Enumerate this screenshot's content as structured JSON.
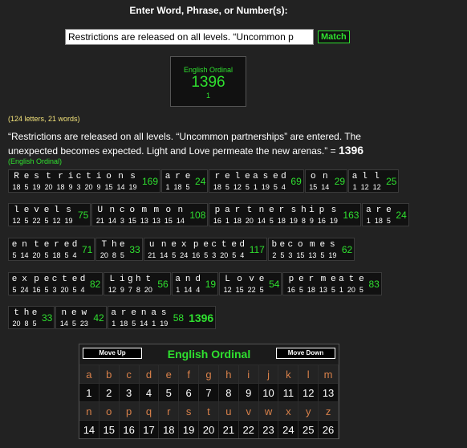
{
  "header": {
    "label": "Enter Word, Phrase, or Number(s):"
  },
  "input": {
    "value": "Restrictions are released on all levels.  “Uncommon p"
  },
  "match_button": {
    "label": "Match"
  },
  "cipher_box": {
    "name": "English Ordinal",
    "total": "1396",
    "rank": "1"
  },
  "counts": "(124 letters, 21 words)",
  "quote": {
    "text": "“Restrictions are released on all levels. “Uncommon partnerships” are entered. The unexpected becomes expected. Light and Love permeate the new arenas.”",
    "equals": " = ",
    "total": "1396",
    "cipher": "(English Ordinal)"
  },
  "rows": [
    [
      {
        "word": "Restrictions",
        "values": [
          "18",
          "5",
          "19",
          "20",
          "18",
          "9",
          "3",
          "20",
          "9",
          "15",
          "14",
          "19"
        ],
        "sum": "169"
      },
      {
        "word": "are",
        "values": [
          "1",
          "18",
          "5"
        ],
        "sum": "24"
      },
      {
        "word": "released",
        "values": [
          "18",
          "5",
          "12",
          "5",
          "1",
          "19",
          "5",
          "4"
        ],
        "sum": "69"
      },
      {
        "word": "on",
        "values": [
          "15",
          "14"
        ],
        "sum": "29"
      },
      {
        "word": "all",
        "values": [
          "1",
          "12",
          "12"
        ],
        "sum": "25"
      }
    ],
    [
      {
        "word": "levels",
        "values": [
          "12",
          "5",
          "22",
          "5",
          "12",
          "19"
        ],
        "sum": "75"
      },
      {
        "word": "Uncommon",
        "values": [
          "21",
          "14",
          "3",
          "15",
          "13",
          "13",
          "15",
          "14"
        ],
        "sum": "108"
      },
      {
        "word": "partnerships",
        "values": [
          "16",
          "1",
          "18",
          "20",
          "14",
          "5",
          "18",
          "19",
          "8",
          "9",
          "16",
          "19"
        ],
        "sum": "163"
      },
      {
        "word": "are",
        "values": [
          "1",
          "18",
          "5"
        ],
        "sum": "24"
      }
    ],
    [
      {
        "word": "entered",
        "values": [
          "5",
          "14",
          "20",
          "5",
          "18",
          "5",
          "4"
        ],
        "sum": "71"
      },
      {
        "word": "The",
        "values": [
          "20",
          "8",
          "5"
        ],
        "sum": "33"
      },
      {
        "word": "unexpected",
        "values": [
          "21",
          "14",
          "5",
          "24",
          "16",
          "5",
          "3",
          "20",
          "5",
          "4"
        ],
        "sum": "117"
      },
      {
        "word": "becomes",
        "values": [
          "2",
          "5",
          "3",
          "15",
          "13",
          "5",
          "19"
        ],
        "sum": "62"
      }
    ],
    [
      {
        "word": "expected",
        "values": [
          "5",
          "24",
          "16",
          "5",
          "3",
          "20",
          "5",
          "4"
        ],
        "sum": "82"
      },
      {
        "word": "Light",
        "values": [
          "12",
          "9",
          "7",
          "8",
          "20"
        ],
        "sum": "56"
      },
      {
        "word": "and",
        "values": [
          "1",
          "14",
          "4"
        ],
        "sum": "19"
      },
      {
        "word": "Love",
        "values": [
          "12",
          "15",
          "22",
          "5"
        ],
        "sum": "54"
      },
      {
        "word": "permeate",
        "values": [
          "16",
          "5",
          "18",
          "13",
          "5",
          "1",
          "20",
          "5"
        ],
        "sum": "83"
      }
    ],
    [
      {
        "word": "the",
        "values": [
          "20",
          "8",
          "5"
        ],
        "sum": "33"
      },
      {
        "word": "new",
        "values": [
          "14",
          "5",
          "23"
        ],
        "sum": "42"
      },
      {
        "word": "arenas",
        "values": [
          "1",
          "18",
          "5",
          "14",
          "1",
          "19"
        ],
        "sum": "58"
      }
    ]
  ],
  "final_total": "1396",
  "table": {
    "move_up": "Move Up",
    "move_down": "Move Down",
    "title": "English Ordinal",
    "letters_row1": [
      "a",
      "b",
      "c",
      "d",
      "e",
      "f",
      "g",
      "h",
      "i",
      "j",
      "k",
      "l",
      "m"
    ],
    "numbers_row1": [
      "1",
      "2",
      "3",
      "4",
      "5",
      "6",
      "7",
      "8",
      "9",
      "10",
      "11",
      "12",
      "13"
    ],
    "letters_row2": [
      "n",
      "o",
      "p",
      "q",
      "r",
      "s",
      "t",
      "u",
      "v",
      "w",
      "x",
      "y",
      "z"
    ],
    "numbers_row2": [
      "14",
      "15",
      "16",
      "17",
      "18",
      "19",
      "20",
      "21",
      "22",
      "23",
      "24",
      "25",
      "26"
    ]
  }
}
